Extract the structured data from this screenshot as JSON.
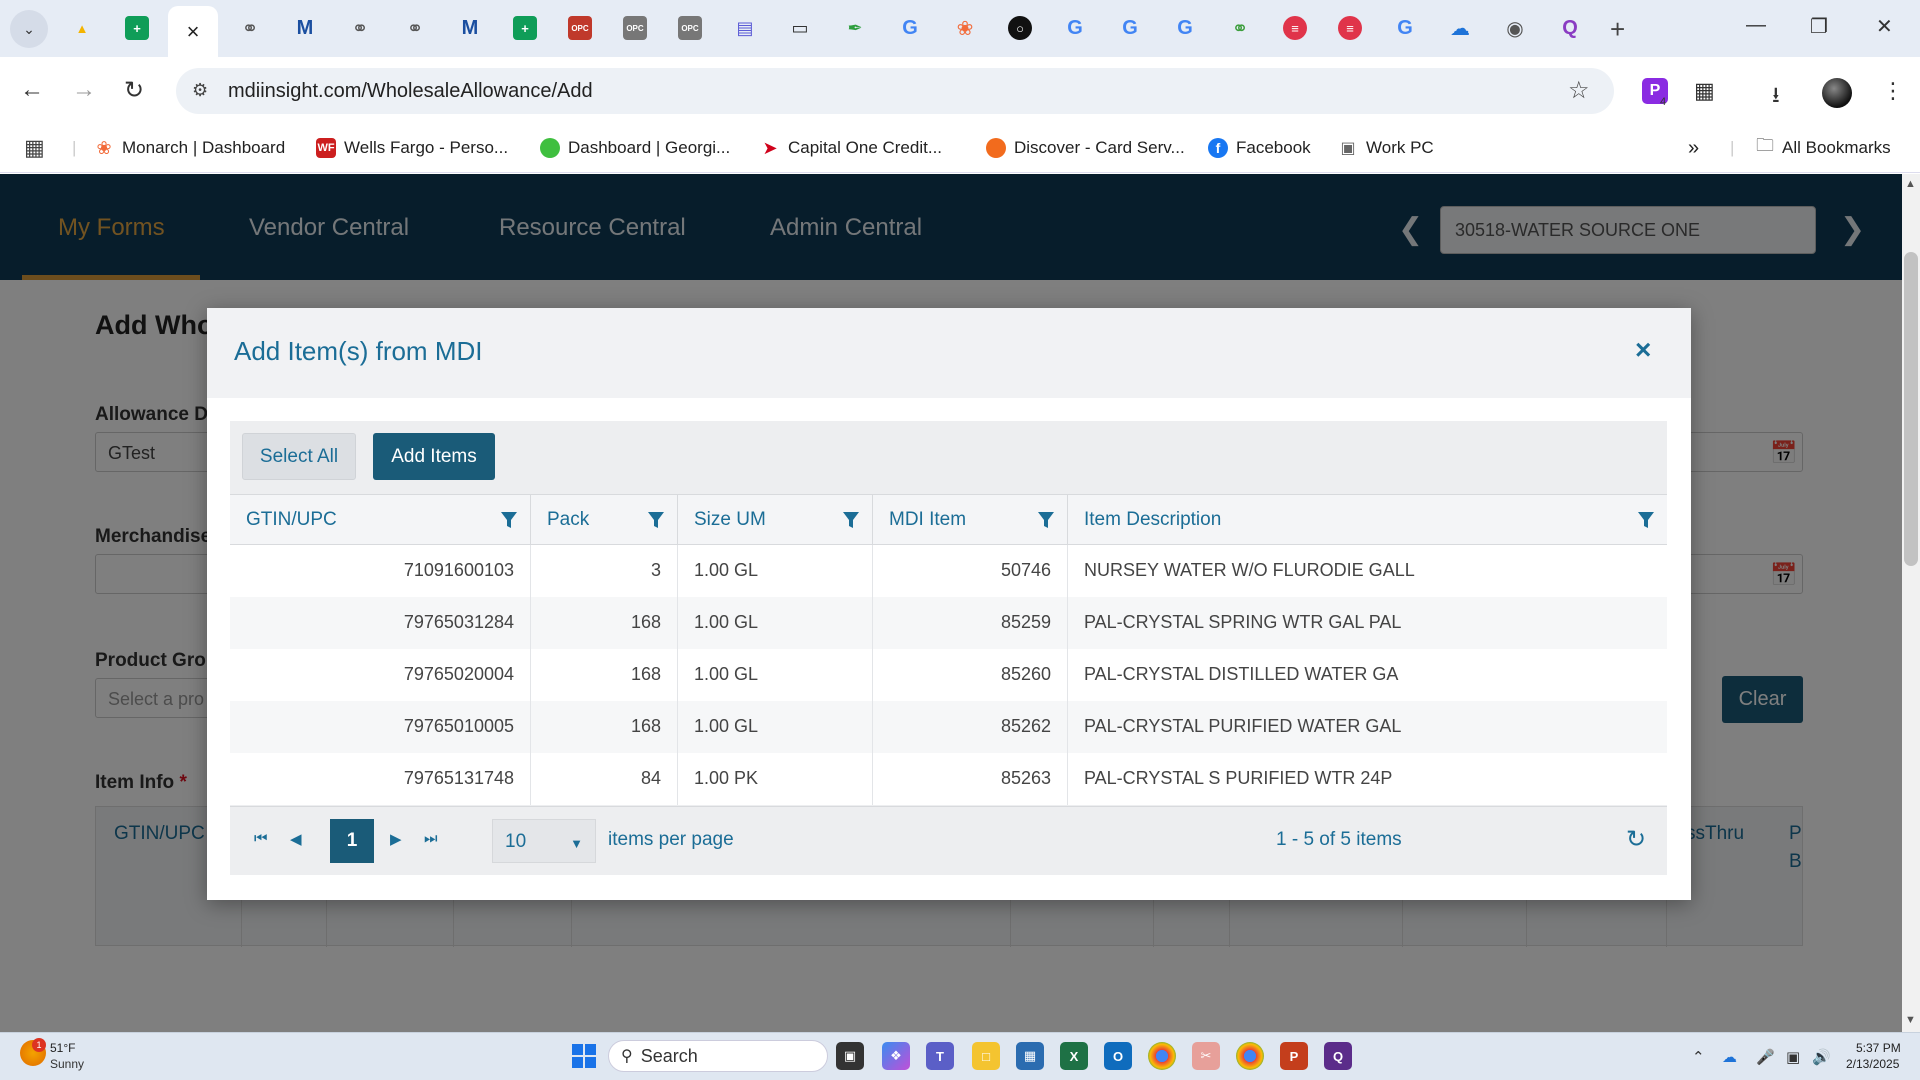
{
  "browser": {
    "url": "mdiinsight.com/WholesaleAllowance/Add",
    "extension_badge": "4",
    "bookmarks": [
      {
        "label": "Monarch | Dashboard",
        "icon": "monarch-icon"
      },
      {
        "label": "Wells Fargo - Perso...",
        "icon": "wells-fargo-icon",
        "icon_text": "WF"
      },
      {
        "label": "Dashboard | Georgi...",
        "icon": "georgia-icon"
      },
      {
        "label": "Capital One Credit...",
        "icon": "capital-one-icon"
      },
      {
        "label": "Discover - Card Serv...",
        "icon": "discover-icon"
      },
      {
        "label": "Facebook",
        "icon": "facebook-icon",
        "icon_text": "f"
      },
      {
        "label": "Work PC",
        "icon": "work-pc-icon"
      }
    ],
    "all_bookmarks": "All Bookmarks"
  },
  "app": {
    "nav": [
      "My Forms",
      "Vendor Central",
      "Resource Central",
      "Admin Central"
    ],
    "vendor": "30518-WATER SOURCE ONE"
  },
  "page": {
    "title": "Add Who",
    "allowance_label": "Allowance De",
    "allowance_value": "GTest",
    "merchandise_label": "Merchandise",
    "product_group_label": "Product Grou",
    "product_group_placeholder": "Select a pro",
    "item_info_label": "Item Info",
    "required_mark": "*",
    "clear_label": "Clear",
    "grid_header_left": "GTIN/UPC",
    "grid_header_right": "ssThru",
    "grid_header_far": "P",
    "grid_header_far2": "B"
  },
  "modal": {
    "title": "Add Item(s) from MDI",
    "close": "×",
    "select_all": "Select All",
    "add_items": "Add Items",
    "columns": [
      "GTIN/UPC",
      "Pack",
      "Size UM",
      "MDI Item",
      "Item Description"
    ],
    "rows": [
      {
        "gtin": "71091600103",
        "pack": "3",
        "size": "1.00 GL",
        "mdi": "50746",
        "desc": "NURSEY WATER W/O FLURODIE GALL"
      },
      {
        "gtin": "79765031284",
        "pack": "168",
        "size": "1.00 GL",
        "mdi": "85259",
        "desc": "PAL-CRYSTAL SPRING WTR GAL PAL"
      },
      {
        "gtin": "79765020004",
        "pack": "168",
        "size": "1.00 GL",
        "mdi": "85260",
        "desc": "PAL-CRYSTAL DISTILLED WATER GA"
      },
      {
        "gtin": "79765010005",
        "pack": "168",
        "size": "1.00 GL",
        "mdi": "85262",
        "desc": "PAL-CRYSTAL PURIFIED WATER GAL"
      },
      {
        "gtin": "79765131748",
        "pack": "84",
        "size": "1.00 PK",
        "mdi": "85263",
        "desc": "PAL-CRYSTAL S PURIFIED WTR 24P"
      }
    ],
    "pager": {
      "current_page": "1",
      "page_size": "10",
      "items_per_page": "items per page",
      "info": "1 - 5 of 5 items"
    }
  },
  "taskbar": {
    "weather_temp": "51°F",
    "weather_desc": "Sunny",
    "weather_badge": "1",
    "search": "Search",
    "time": "5:37 PM",
    "date": "2/13/2025"
  },
  "colors": {
    "nav_bg": "#0f3b57",
    "accent": "#1b6d96",
    "primary_button": "#1a5b78",
    "active_nav": "#e5a642"
  }
}
